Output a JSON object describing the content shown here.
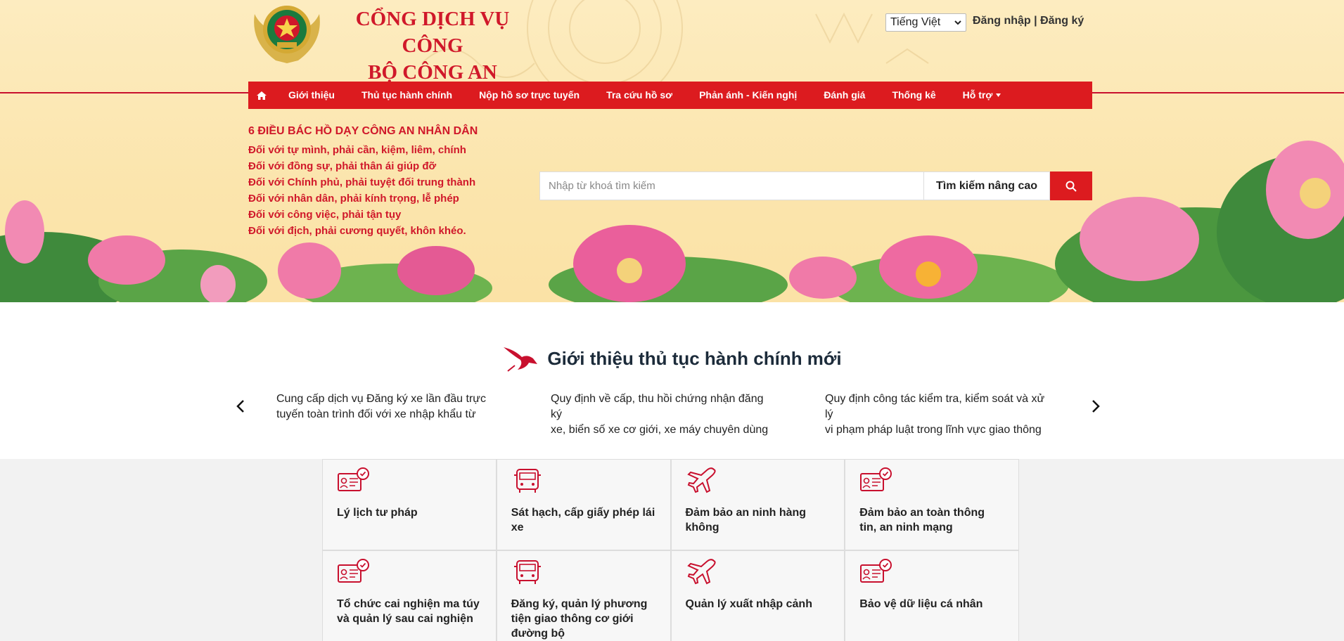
{
  "header": {
    "title_line1": "CỔNG DỊCH VỤ CÔNG",
    "title_line2": "BỘ CÔNG AN",
    "language": "Tiếng Việt",
    "login": "Đăng nhập",
    "separator": "|",
    "register": "Đăng ký"
  },
  "nav": {
    "home_icon": "home-icon",
    "items": [
      {
        "label": "Giới thiệu"
      },
      {
        "label": "Thủ tục hành chính"
      },
      {
        "label": "Nộp hồ sơ trực tuyến"
      },
      {
        "label": "Tra cứu hồ sơ"
      },
      {
        "label": "Phản ánh - Kiến nghị"
      },
      {
        "label": "Đánh giá"
      },
      {
        "label": "Thống kê"
      },
      {
        "label": "Hỗ trợ"
      }
    ]
  },
  "teachings": {
    "title": "6 ĐIỀU BÁC HỒ DẠY CÔNG AN NHÂN DÂN",
    "lines": [
      "Đối với tự mình, phải cần, kiệm, liêm, chính",
      "Đối với đồng sự, phải thân ái giúp đỡ",
      "Đối với Chính phủ, phải tuyệt đối trung thành",
      "Đối với nhân dân, phải kính trọng, lễ phép",
      "Đối với công việc, phải tận tụy",
      "Đối với địch, phải cương quyết, khôn khéo."
    ]
  },
  "search": {
    "placeholder": "Nhập từ khoá tìm kiếm",
    "advanced": "Tìm kiếm nâng cao"
  },
  "intro": {
    "title": "Giới thiệu thủ tục hành chính mới",
    "items": [
      {
        "line1": "Cung cấp dịch vụ Đăng ký xe lần đầu trực",
        "line2": "tuyến toàn trình đối với xe nhập khẩu từ"
      },
      {
        "line1": "Quy định về cấp, thu hồi chứng nhận đăng ký",
        "line2": "xe, biển số xe cơ giới, xe máy chuyên dùng"
      },
      {
        "line1": "Quy định công tác kiểm tra, kiểm soát và xử lý",
        "line2": "vi phạm pháp luật trong lĩnh vực giao thông"
      }
    ]
  },
  "services": [
    {
      "icon": "certificate-icon",
      "label": "Lý lịch tư pháp"
    },
    {
      "icon": "bus-icon",
      "label": "Sát hạch, cấp giấy phép lái xe"
    },
    {
      "icon": "airplane-icon",
      "label": "Đảm bảo an ninh hàng không"
    },
    {
      "icon": "certificate-icon",
      "label": "Đảm bảo an toàn thông tin, an ninh mạng"
    },
    {
      "icon": "certificate-icon",
      "label": "Tổ chức cai nghiện ma túy và quản lý sau cai nghiện"
    },
    {
      "icon": "bus-icon",
      "label": "Đăng ký, quản lý phương tiện giao thông cơ giới đường bộ"
    },
    {
      "icon": "airplane-icon",
      "label": "Quản lý xuất nhập cảnh"
    },
    {
      "icon": "certificate-icon",
      "label": "Bảo vệ dữ liệu cá nhân"
    }
  ],
  "colors": {
    "brand_red": "#dc1b1f",
    "banner_bg": "#fbe5ad"
  }
}
